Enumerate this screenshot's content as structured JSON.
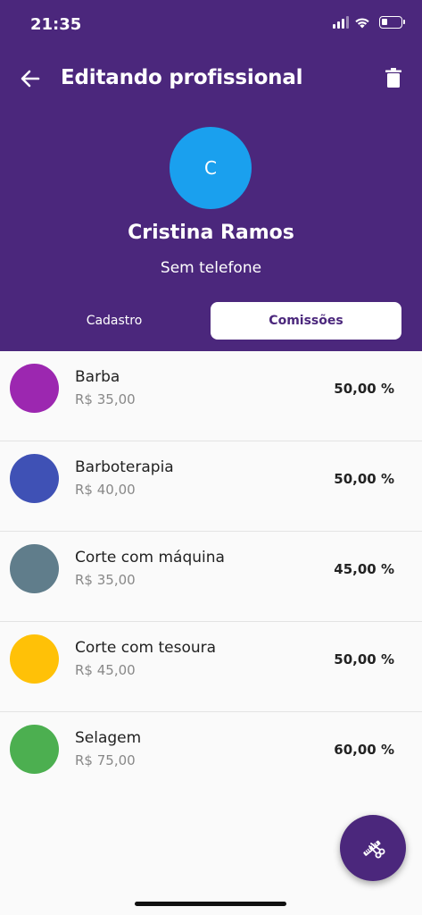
{
  "status_bar": {
    "time": "21:35"
  },
  "appbar": {
    "title": "Editando profissional"
  },
  "profile": {
    "avatar_initial": "C",
    "name": "Cristina Ramos",
    "phone": "Sem telefone"
  },
  "tabs": [
    {
      "label": "Cadastro",
      "active": false
    },
    {
      "label": "Comissões",
      "active": true
    }
  ],
  "services": [
    {
      "name": "Barba",
      "price": "R$ 35,00",
      "commission": "50,00 %",
      "color": "#9c27b0"
    },
    {
      "name": "Barboterapia",
      "price": "R$ 40,00",
      "commission": "50,00 %",
      "color": "#3f51b5"
    },
    {
      "name": "Corte com máquina",
      "price": "R$ 35,00",
      "commission": "45,00 %",
      "color": "#607d8b"
    },
    {
      "name": "Corte com tesoura",
      "price": "R$ 45,00",
      "commission": "50,00 %",
      "color": "#ffc107"
    },
    {
      "name": "Selagem",
      "price": "R$ 75,00",
      "commission": "60,00 %",
      "color": "#4caf50"
    }
  ],
  "colors": {
    "primary": "#4b277c",
    "avatar": "#1aa0ee"
  },
  "icons": {
    "back": "arrow-left-icon",
    "delete": "trash-icon",
    "fab": "scissors-comb-icon"
  }
}
